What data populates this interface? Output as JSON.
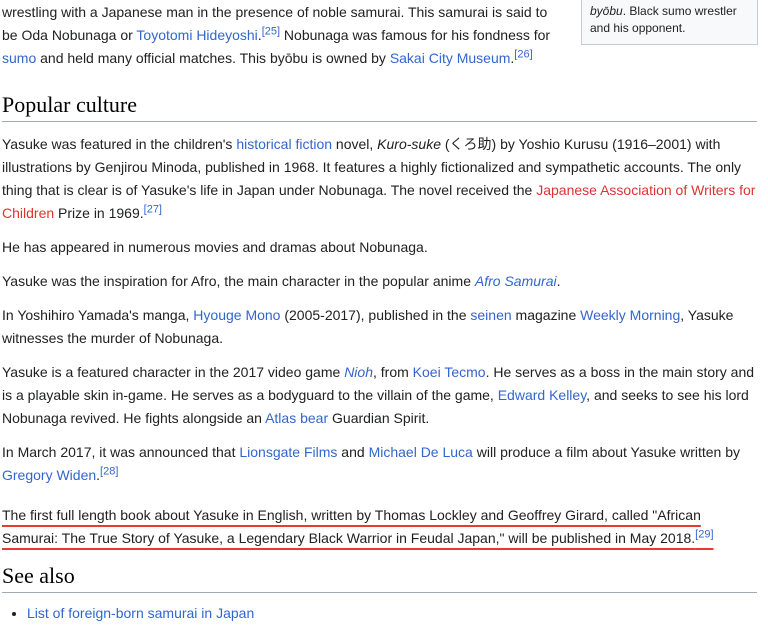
{
  "colors": {
    "text": "#202122",
    "link_blue": "#3366cc",
    "red_link": "#dd3333",
    "heading_rule": "#a2a9b1",
    "annotation_red": "#e63b2e",
    "caption_background": "#f8f9fa",
    "caption_border": "#c8ccd1"
  },
  "infobox_caption": {
    "segments": [
      {
        "t": "italic",
        "text": "byōbu"
      },
      {
        "t": "plain",
        "text": ". Black sumo wrestler and his opponent."
      }
    ]
  },
  "lead_paragraph": {
    "segments": [
      {
        "t": "plain",
        "text": "wrestling with a Japanese man in the presence of noble samurai. This samurai is said to be Oda Nobunaga or "
      },
      {
        "t": "link",
        "text": "Toyotomi Hideyoshi"
      },
      {
        "t": "plain",
        "text": "."
      },
      {
        "t": "ref",
        "text": "[25]"
      },
      {
        "t": "plain",
        "text": " Nobunaga was famous for his fondness for "
      },
      {
        "t": "link",
        "text": "sumo"
      },
      {
        "t": "plain",
        "text": " and held many official matches. This byōbu is owned by "
      },
      {
        "t": "link",
        "text": "Sakai City Museum"
      },
      {
        "t": "plain",
        "text": "."
      },
      {
        "t": "ref",
        "text": "[26]"
      }
    ]
  },
  "sections": {
    "popular_culture": {
      "heading": "Popular culture",
      "paragraphs": [
        {
          "segments": [
            {
              "t": "plain",
              "text": "Yasuke was featured in the children's "
            },
            {
              "t": "link",
              "text": "historical fiction"
            },
            {
              "t": "plain",
              "text": " novel, "
            },
            {
              "t": "italic",
              "text": "Kuro-suke"
            },
            {
              "t": "plain",
              "text": " (くろ助) by Yoshio Kurusu (1916–2001) with illustrations by Genjirou Minoda, published in 1968. It features a highly fictionalized and sympathetic accounts. The only thing that is clear is of Yasuke's life in Japan under Nobunaga. The novel received the "
            },
            {
              "t": "redlink",
              "text": "Japanese Association of Writers for Children"
            },
            {
              "t": "plain",
              "text": " Prize in 1969."
            },
            {
              "t": "ref",
              "text": "[27]"
            }
          ]
        },
        {
          "segments": [
            {
              "t": "plain",
              "text": "He has appeared in numerous movies and dramas about Nobunaga."
            }
          ]
        },
        {
          "segments": [
            {
              "t": "plain",
              "text": "Yasuke was the inspiration for Afro, the main character in the popular anime "
            },
            {
              "t": "ilink",
              "text": "Afro Samurai"
            },
            {
              "t": "plain",
              "text": "."
            }
          ]
        },
        {
          "segments": [
            {
              "t": "plain",
              "text": "In Yoshihiro Yamada's manga, "
            },
            {
              "t": "link",
              "text": "Hyouge Mono"
            },
            {
              "t": "plain",
              "text": " (2005-2017), published in the "
            },
            {
              "t": "link",
              "text": "seinen"
            },
            {
              "t": "plain",
              "text": " magazine "
            },
            {
              "t": "link",
              "text": "Weekly Morning"
            },
            {
              "t": "plain",
              "text": ", Yasuke witnesses the murder of Nobunaga."
            }
          ]
        },
        {
          "segments": [
            {
              "t": "plain",
              "text": "Yasuke is a featured character in the 2017 video game "
            },
            {
              "t": "ilink",
              "text": "Nioh"
            },
            {
              "t": "plain",
              "text": ", from "
            },
            {
              "t": "link",
              "text": "Koei Tecmo"
            },
            {
              "t": "plain",
              "text": ". He serves as a boss in the main story and is a playable skin in-game. He serves as a bodyguard to the villain of the game, "
            },
            {
              "t": "link",
              "text": "Edward Kelley"
            },
            {
              "t": "plain",
              "text": ", and seeks to see his lord Nobunaga revived. He fights alongside an "
            },
            {
              "t": "link",
              "text": "Atlas bear"
            },
            {
              "t": "plain",
              "text": " Guardian Spirit."
            }
          ]
        },
        {
          "segments": [
            {
              "t": "plain",
              "text": "In March 2017, it was announced that "
            },
            {
              "t": "link",
              "text": "Lionsgate Films"
            },
            {
              "t": "plain",
              "text": " and "
            },
            {
              "t": "link",
              "text": "Michael De Luca"
            },
            {
              "t": "plain",
              "text": " will produce a film about Yasuke written by "
            },
            {
              "t": "link",
              "text": "Gregory Widen"
            },
            {
              "t": "plain",
              "text": "."
            },
            {
              "t": "ref",
              "text": "[28]"
            }
          ]
        },
        {
          "annotated": true,
          "segments": [
            {
              "t": "plain",
              "text": "The first full length book about Yasuke in English, written by Thomas Lockley and Geoffrey Girard, called \"African Samurai: The True Story of Yasuke, a Legendary Black Warrior in Feudal Japan,\" will be published in May 2018."
            },
            {
              "t": "ref",
              "text": "[29]"
            }
          ]
        }
      ]
    },
    "see_also": {
      "heading": "See also",
      "items": [
        {
          "label": "List of foreign-born samurai in Japan"
        }
      ]
    }
  }
}
